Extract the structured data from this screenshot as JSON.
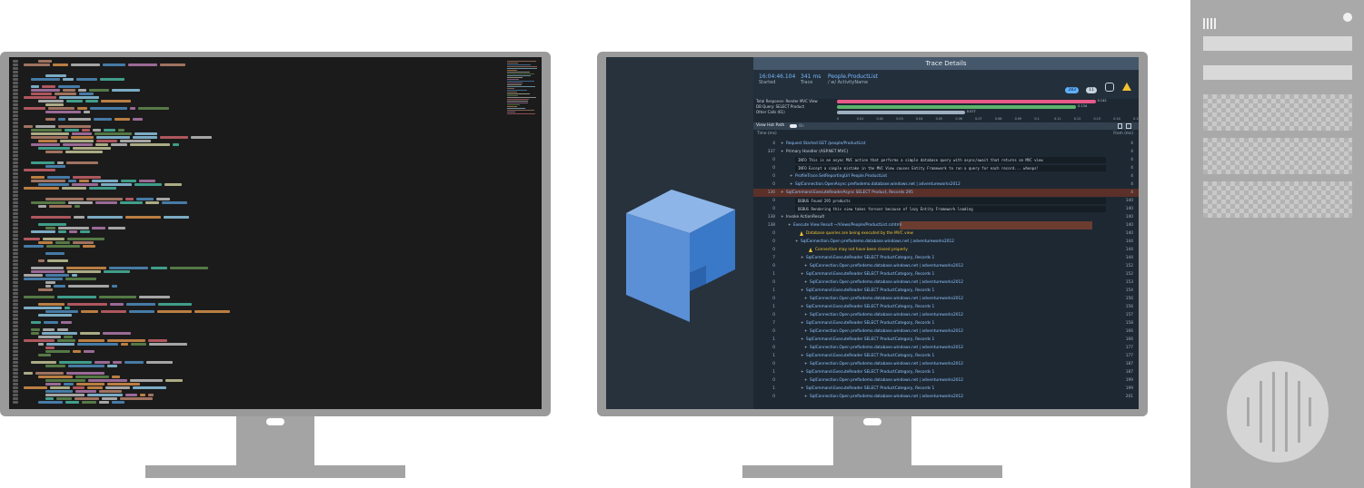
{
  "trace": {
    "title": "Trace Details",
    "time": "16:04:46.104",
    "time_label": "Started",
    "duration": "341 ms",
    "duration_label": "Trace",
    "name": "People.ProductList",
    "name_sub": "/ w/ ActivityName",
    "badges": [
      "283",
      "11"
    ],
    "legend": [
      {
        "label": "Total Response: Render MVC View",
        "value": "0.142",
        "color": "#e85a88",
        "frac": 0.93
      },
      {
        "label": "DB Query: SELECT Product",
        "value": "0.134",
        "color": "#5db36b",
        "frac": 0.86
      },
      {
        "label": "Other Calls (61)",
        "value": "0.077",
        "color": "#9fb0c0",
        "frac": 0.46
      }
    ],
    "axis_ticks": [
      "0",
      "0.01",
      "0.02",
      "0.03",
      "0.04",
      "0.05",
      "0.06",
      "0.07",
      "0.08",
      "0.09",
      "0.1",
      "0.11",
      "0.12",
      "0.13",
      "0.14",
      "0.15"
    ],
    "hotpath_label": "View Hot Path",
    "hotpath_toggle": "On",
    "col_time": "Time (ms)",
    "col_from": "From (ms)"
  },
  "rows": [
    {
      "ms": "4",
      "indent": 6,
      "text": "Request Started  GET /people/ProductList",
      "right": "4",
      "kind": "link-tail"
    },
    {
      "ms": "337",
      "indent": 6,
      "text": "Primary Handler (ASP.NET MVC)",
      "right": "4",
      "kind": "plain"
    },
    {
      "ms": "0",
      "indent": 16,
      "text": "INFO This is an async MVC action that performs a simple database query with async/await that returns an MVC view",
      "right": "4",
      "kind": "console"
    },
    {
      "ms": "0",
      "indent": 16,
      "text": "INFO Except a simple mistake in the MVC View causes Entity Framework to run a query for each record... whoops!",
      "right": "4",
      "kind": "console"
    },
    {
      "ms": "0",
      "indent": 16,
      "text": "ProfileTrace.SetReportingUrl  People.ProductList",
      "right": "4",
      "kind": "link-tail"
    },
    {
      "ms": "0",
      "indent": 16,
      "text": "SqlConnection.OpenAsync  prefixdemo.database.windows.net | adventureworks2012",
      "right": "4",
      "kind": "link-tail"
    },
    {
      "ms": "136",
      "indent": 6,
      "text": "SqlCommand.ExecuteReaderAsync  SELECT Product, Records 295",
      "right": "4",
      "kind": "hot"
    },
    {
      "ms": "0",
      "indent": 16,
      "text": "DEBUG Found 295 products",
      "right": "140",
      "kind": "console"
    },
    {
      "ms": "0",
      "indent": 16,
      "text": "DEBUG Rendering this view takes forever because of lazy Entity Framework loading",
      "right": "140",
      "kind": "console"
    },
    {
      "ms": "138",
      "indent": 6,
      "text": "Invoke ActionResult",
      "right": "140",
      "kind": "plain"
    },
    {
      "ms": "138",
      "indent": 14,
      "text": "Execute View Result  ~/Views/People/ProductList.cshtml",
      "right": "140",
      "kind": "hot-tail"
    },
    {
      "ms": "0",
      "indent": 28,
      "text": "Database queries are being executed by the MVC view",
      "right": "140",
      "kind": "warn"
    },
    {
      "ms": "0",
      "indent": 22,
      "text": "SqlConnection.Open  prefixdemo.database.windows.net | adventureworks2012",
      "right": "144",
      "kind": "link-tail"
    },
    {
      "ms": "0",
      "indent": 38,
      "text": "Connection may not have been closed properly",
      "right": "144",
      "kind": "warn"
    },
    {
      "ms": "7",
      "indent": 28,
      "text": "SqlCommand.ExecuteReader  SELECT ProductCategory, Records 1",
      "right": "144",
      "kind": "link-tail"
    },
    {
      "ms": "0",
      "indent": 32,
      "text": "SqlConnection.Open  prefixdemo.database.windows.net | adventureworks2012",
      "right": "152",
      "kind": "link-tail"
    },
    {
      "ms": "1",
      "indent": 28,
      "text": "SqlCommand.ExecuteReader  SELECT ProductCategory, Records 1",
      "right": "152",
      "kind": "link-tail"
    },
    {
      "ms": "0",
      "indent": 32,
      "text": "SqlConnection.Open  prefixdemo.database.windows.net | adventureworks2012",
      "right": "153",
      "kind": "link-tail"
    },
    {
      "ms": "1",
      "indent": 28,
      "text": "SqlCommand.ExecuteReader  SELECT ProductCategory, Records 1",
      "right": "154",
      "kind": "link-tail"
    },
    {
      "ms": "0",
      "indent": 32,
      "text": "SqlConnection.Open  prefixdemo.database.windows.net | adventureworks2012",
      "right": "156",
      "kind": "link-tail"
    },
    {
      "ms": "1",
      "indent": 28,
      "text": "SqlCommand.ExecuteReader  SELECT ProductCategory, Records 1",
      "right": "156",
      "kind": "link-tail"
    },
    {
      "ms": "0",
      "indent": 32,
      "text": "SqlConnection.Open  prefixdemo.database.windows.net | adventureworks2012",
      "right": "157",
      "kind": "link-tail"
    },
    {
      "ms": "7",
      "indent": 28,
      "text": "SqlCommand.ExecuteReader  SELECT ProductCategory, Records 1",
      "right": "158",
      "kind": "link-tail"
    },
    {
      "ms": "0",
      "indent": 32,
      "text": "SqlConnection.Open  prefixdemo.database.windows.net | adventureworks2012",
      "right": "166",
      "kind": "link-tail"
    },
    {
      "ms": "1",
      "indent": 28,
      "text": "SqlCommand.ExecuteReader  SELECT ProductCategory, Records 1",
      "right": "166",
      "kind": "link-tail"
    },
    {
      "ms": "0",
      "indent": 32,
      "text": "SqlConnection.Open  prefixdemo.database.windows.net | adventureworks2012",
      "right": "177",
      "kind": "link-tail"
    },
    {
      "ms": "1",
      "indent": 28,
      "text": "SqlCommand.ExecuteReader  SELECT ProductCategory, Records 1",
      "right": "177",
      "kind": "link-tail"
    },
    {
      "ms": "0",
      "indent": 32,
      "text": "SqlConnection.Open  prefixdemo.database.windows.net | adventureworks2012",
      "right": "187",
      "kind": "link-tail"
    },
    {
      "ms": "1",
      "indent": 28,
      "text": "SqlCommand.ExecuteReader  SELECT ProductCategory, Records 1",
      "right": "187",
      "kind": "link-tail"
    },
    {
      "ms": "0",
      "indent": 32,
      "text": "SqlConnection.Open  prefixdemo.database.windows.net | adventureworks2012",
      "right": "199",
      "kind": "link-tail"
    },
    {
      "ms": "1",
      "indent": 28,
      "text": "SqlCommand.ExecuteReader  SELECT ProductCategory, Records 1",
      "right": "199",
      "kind": "link-tail"
    },
    {
      "ms": "0",
      "indent": 32,
      "text": "SqlConnection.Open  prefixdemo.database.windows.net | adventureworks2012",
      "right": "201",
      "kind": "link-tail"
    }
  ]
}
